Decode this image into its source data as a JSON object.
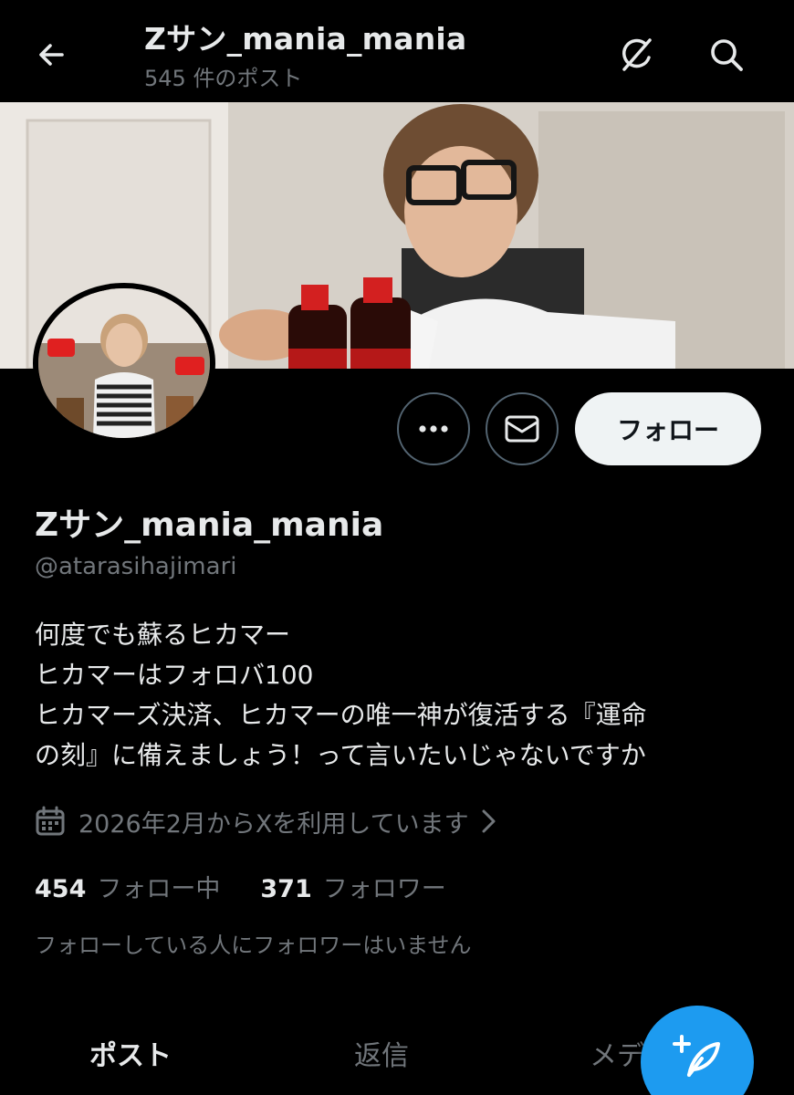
{
  "header": {
    "title": "Zサン_mania_mania",
    "post_count": "545 件のポスト"
  },
  "profile": {
    "display_name": "Zサン_mania_mania",
    "handle": "@atarasihajimari",
    "follow_label": "フォロー",
    "bio_lines": [
      "何度でも蘇るヒカマー",
      "ヒカマーはフォロバ100",
      "ヒカマーズ決済、ヒカマーの唯一神が復活する『運命",
      "の刻』に備えましょう！って言いたいじゃないですか"
    ],
    "joined": "2026年2月からXを利用しています",
    "following_count": "454",
    "following_label": "フォロー中",
    "followers_count": "371",
    "followers_label": "フォロワー",
    "mutual_note": "フォローしている人にフォロワーはいません"
  },
  "tabs": [
    {
      "label": "ポスト"
    },
    {
      "label": "返信"
    },
    {
      "label": "メディ"
    }
  ],
  "colors": {
    "background": "#000000",
    "text_primary": "#e7e9ea",
    "text_secondary": "#71767b",
    "accent": "#1d9bf0",
    "follow_button_bg": "#eff3f4"
  },
  "icons": {
    "back": "arrow-left-icon",
    "grok": "grok-icon",
    "search": "search-icon",
    "more": "more-horizontal-icon",
    "message": "mail-icon",
    "calendar": "calendar-icon",
    "chevron": "chevron-right-icon",
    "compose": "compose-post-icon"
  }
}
